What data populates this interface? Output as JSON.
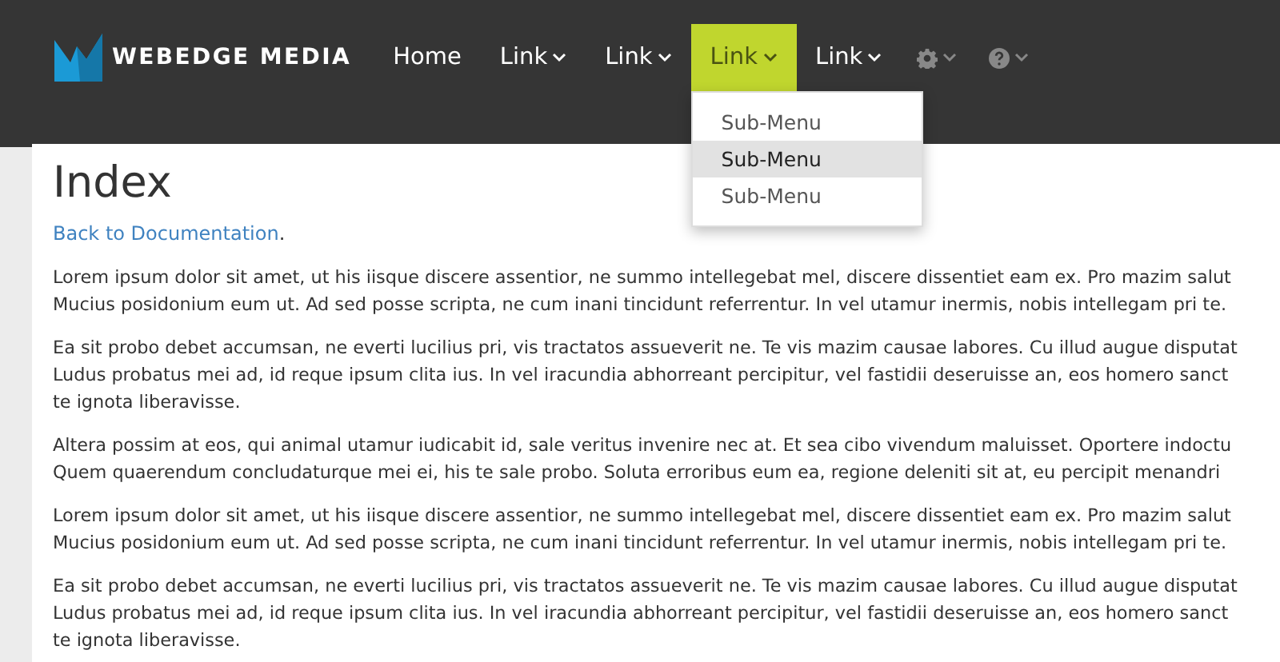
{
  "brand": {
    "name": "WEBEDGE MEDIA"
  },
  "nav": [
    {
      "kind": "text",
      "label": "Home",
      "selected": false
    },
    {
      "kind": "dropdown",
      "label": "Link",
      "selected": false
    },
    {
      "kind": "dropdown",
      "label": "Link",
      "selected": false
    },
    {
      "kind": "dropdown",
      "label": "Link",
      "selected": true
    },
    {
      "kind": "dropdown",
      "label": "Link",
      "selected": false
    },
    {
      "kind": "gear",
      "selected": false
    },
    {
      "kind": "help",
      "selected": false
    }
  ],
  "dropdown": {
    "items": [
      {
        "label": "Sub-Menu",
        "selected": false
      },
      {
        "label": "Sub-Menu",
        "selected": true
      },
      {
        "label": "Sub-Menu",
        "selected": false
      }
    ]
  },
  "page": {
    "title": "Index",
    "back_link": "Back to Documentation",
    "back_link_end": ".",
    "paragraphs": [
      {
        "lines": [
          "Lorem ipsum dolor sit amet, ut his iisque discere assentior, ne summo intellegebat mel, discere dissentiet eam ex. Pro mazim salut",
          "Mucius posidonium eum ut. Ad sed posse scripta, ne cum inani tincidunt referrentur. In vel utamur inermis, nobis intellegam pri te."
        ]
      },
      {
        "lines": [
          "Ea sit probo debet accumsan, ne everti lucilius pri, vis tractatos assueverit ne. Te vis mazim causae labores. Cu illud augue disputat",
          "Ludus probatus mei ad, id reque ipsum clita ius. In vel iracundia abhorreant percipitur, vel fastidii deseruisse an, eos homero sanct",
          "te ignota liberavisse."
        ]
      },
      {
        "lines": [
          "Altera possim at eos, qui animal utamur iudicabit id, sale veritus invenire nec at. Et sea cibo vivendum maluisset. Oportere indoctu",
          "Quem quaerendum concludaturque mei ei, his te sale probo. Soluta erroribus eum ea, regione deleniti sit at, eu percipit menandri"
        ]
      },
      {
        "lines": [
          "Lorem ipsum dolor sit amet, ut his iisque discere assentior, ne summo intellegebat mel, discere dissentiet eam ex. Pro mazim salut",
          "Mucius posidonium eum ut. Ad sed posse scripta, ne cum inani tincidunt referrentur. In vel utamur inermis, nobis intellegam pri te."
        ]
      },
      {
        "lines": [
          "Ea sit probo debet accumsan, ne everti lucilius pri, vis tractatos assueverit ne. Te vis mazim causae labores. Cu illud augue disputat",
          "Ludus probatus mei ad, id reque ipsum clita ius. In vel iracundia abhorreant percipitur, vel fastidii deseruisse an, eos homero sanct",
          "te ignota liberavisse."
        ]
      }
    ]
  }
}
